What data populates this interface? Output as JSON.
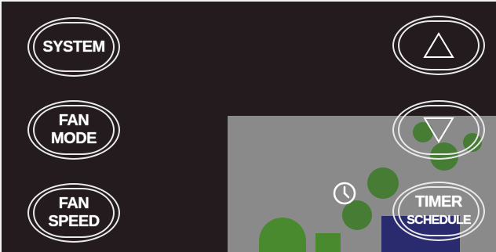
{
  "left_buttons": {
    "system": "SYSTEM",
    "fan_mode": {
      "line1": "FAN",
      "line2": "MODE"
    },
    "fan_speed": {
      "line1": "FAN",
      "line2": "SPEED"
    }
  },
  "right_buttons": {
    "up_icon": "up-triangle",
    "down_icon": "down-triangle",
    "timer": {
      "line1": "TIMER",
      "line2": "SCHEDULE"
    }
  },
  "status_icon": "clock-icon",
  "colors": {
    "panel": "#231b1d",
    "outline": "#e9e9e9",
    "text": "#ffffff"
  }
}
